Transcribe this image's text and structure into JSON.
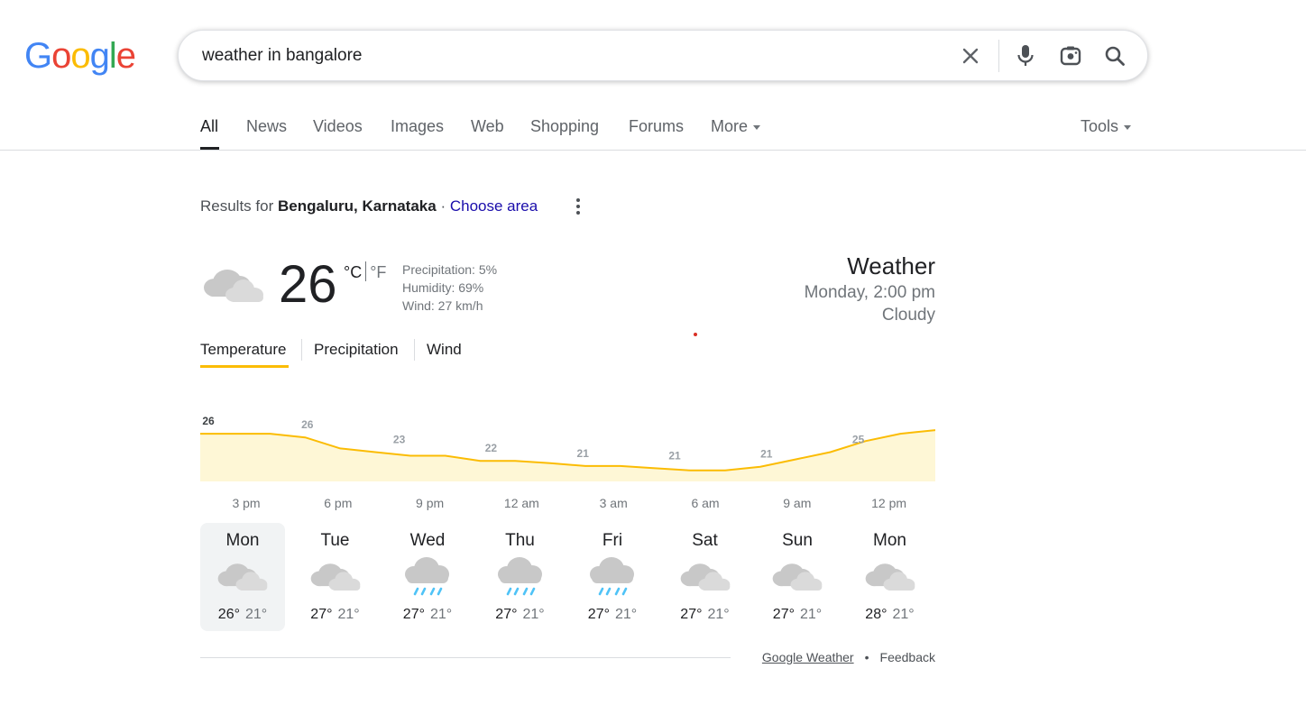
{
  "logo": {
    "letters": [
      "G",
      "o",
      "o",
      "g",
      "l",
      "e"
    ],
    "colors": [
      "#4285F4",
      "#EA4335",
      "#FBBC05",
      "#4285F4",
      "#34A853",
      "#EA4335"
    ]
  },
  "search": {
    "query": "weather in bangalore",
    "icons": [
      "close-icon",
      "mic-icon",
      "lens-icon",
      "search-icon"
    ]
  },
  "tabs": [
    {
      "label": "All",
      "active": true
    },
    {
      "label": "News"
    },
    {
      "label": "Videos"
    },
    {
      "label": "Images"
    },
    {
      "label": "Web"
    },
    {
      "label": "Shopping"
    },
    {
      "label": "Forums"
    },
    {
      "label": "More"
    }
  ],
  "tools_label": "Tools",
  "results_for": {
    "prefix": "Results for",
    "location": "Bengaluru, Karnataka",
    "separator": "·",
    "choose": "Choose area"
  },
  "current": {
    "temp": "26",
    "unit_c": "°C",
    "unit_f": "°F",
    "precipitation": "Precipitation: 5%",
    "humidity": "Humidity: 69%",
    "wind": "Wind: 27 km/h",
    "icon": "cloudy-icon"
  },
  "header": {
    "title": "Weather",
    "time": "Monday, 2:00 pm",
    "condition": "Cloudy"
  },
  "subtabs": [
    {
      "label": "Temperature",
      "active": true
    },
    {
      "label": "Precipitation"
    },
    {
      "label": "Wind"
    }
  ],
  "chart_data": {
    "type": "area",
    "x": [
      "3 pm",
      "6 pm",
      "9 pm",
      "12 am",
      "3 am",
      "6 am",
      "9 am",
      "12 pm"
    ],
    "labels": [
      "26",
      "26",
      "23",
      "22",
      "21",
      "21",
      "21",
      "25"
    ],
    "series": [
      {
        "values": [
          26,
          26,
          26,
          25.5,
          24,
          23.5,
          23,
          23,
          22.3,
          22.3,
          22,
          21.6,
          21.6,
          21.3,
          21,
          21,
          21.5,
          22.5,
          23.5,
          25,
          26,
          26.5
        ]
      }
    ],
    "ylim": [
      19.5,
      27
    ],
    "color": "#fbbc04",
    "fill": "#fef7d6"
  },
  "days": [
    {
      "name": "Mon",
      "hi": "26°",
      "lo": "21°",
      "icon": "cloudy-icon",
      "selected": true
    },
    {
      "name": "Tue",
      "hi": "27°",
      "lo": "21°",
      "icon": "cloudy-icon"
    },
    {
      "name": "Wed",
      "hi": "27°",
      "lo": "21°",
      "icon": "rain-icon"
    },
    {
      "name": "Thu",
      "hi": "27°",
      "lo": "21°",
      "icon": "rain-icon"
    },
    {
      "name": "Fri",
      "hi": "27°",
      "lo": "21°",
      "icon": "rain-icon"
    },
    {
      "name": "Sat",
      "hi": "27°",
      "lo": "21°",
      "icon": "cloudy-icon"
    },
    {
      "name": "Sun",
      "hi": "27°",
      "lo": "21°",
      "icon": "cloudy-icon"
    },
    {
      "name": "Mon",
      "hi": "28°",
      "lo": "21°",
      "icon": "cloudy-icon"
    }
  ],
  "footer": {
    "source": "Google Weather",
    "separator": "•",
    "feedback": "Feedback"
  }
}
